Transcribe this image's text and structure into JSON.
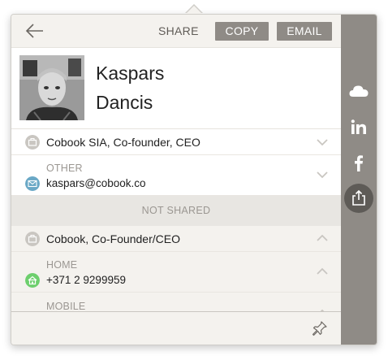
{
  "header": {
    "share_label": "SHARE",
    "copy_label": "COPY",
    "email_label": "EMAIL"
  },
  "profile": {
    "first_name": "Kaspars",
    "last_name": "Dancis"
  },
  "shared": {
    "company": "Cobook SIA, Co-founder, CEO",
    "email_label": "OTHER",
    "email_value": "kaspars@cobook.co"
  },
  "not_shared": {
    "section_label": "NOT SHARED",
    "company": "Cobook, Co-Founder/CEO",
    "phone_label": "HOME",
    "phone_value": "+371 2 9299959",
    "mobile_label": "MOBILE"
  },
  "sidebar": {
    "items": [
      "cloud-icon",
      "linkedin-icon",
      "facebook-icon",
      "share-export-icon"
    ],
    "active": "share-export-icon"
  },
  "colors": {
    "sidebar_bg": "#8f8b86",
    "button_bg": "#8f8b86",
    "email_icon": "#6aa8c6",
    "home_icon": "#6dcf6d",
    "company_icon": "#c9c6c1"
  }
}
